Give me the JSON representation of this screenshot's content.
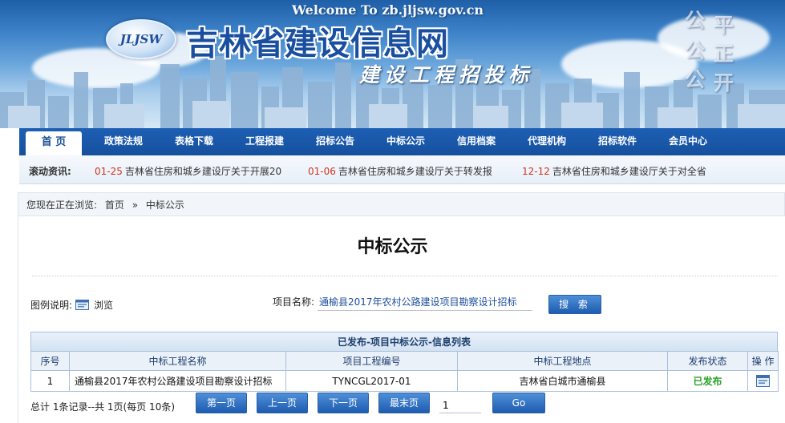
{
  "header": {
    "welcome": "Welcome To zb.jljsw.gov.cn",
    "logo_text": "JLJSW",
    "site_title": "吉林省建设信息网",
    "site_subtitle": "建设工程招投标",
    "slogan_chars": [
      "公",
      "平",
      "公",
      "正",
      "公",
      "开"
    ]
  },
  "nav": {
    "items": [
      "首 页",
      "政策法规",
      "表格下载",
      "工程报建",
      "招标公告",
      "中标公示",
      "信用档案",
      "代理机构",
      "招标软件",
      "会员中心"
    ]
  },
  "ticker": {
    "label": "滚动资讯:",
    "items": [
      {
        "date": "01-25",
        "text": "吉林省住房和城乡建设厅关于开展20"
      },
      {
        "date": "01-06",
        "text": "吉林省住房和城乡建设厅关于转发报"
      },
      {
        "date": "12-12",
        "text": "吉林省住房和城乡建设厅关于对全省"
      }
    ]
  },
  "breadcrumb": {
    "prefix": "您现在正在浏览:",
    "home": "首页",
    "separator": "»",
    "current": "中标公示"
  },
  "page": {
    "title": "中标公示"
  },
  "legend": {
    "label": "图例说明:",
    "icon": "browse-icon",
    "browse_text": "浏览"
  },
  "search": {
    "label": "项目名称:",
    "value": "通榆县2017年农村公路建设项目勘察设计招标",
    "button": "搜 索"
  },
  "table": {
    "caption": "已发布-项目中标公示-信息列表",
    "columns": [
      "序号",
      "中标工程名称",
      "项目工程编号",
      "中标工程地点",
      "发布状态",
      "操 作"
    ],
    "rows": [
      {
        "index": "1",
        "name": "通榆县2017年农村公路建设项目勘察设计招标",
        "code": "TYNCGL2017-01",
        "location": "吉林省白城市通榆县",
        "status": "已发布"
      }
    ]
  },
  "pager": {
    "info": "总计 1条记录--共 1页(每页 10条)",
    "first": "第一页",
    "prev": "上一页",
    "next": "下一页",
    "last": "最末页",
    "page_value": "1",
    "go": "Go"
  },
  "colors": {
    "nav_bg": "#1a56a8",
    "ticker_date": "#d0321e",
    "status_published": "#2aa12a",
    "button_bg": "#1e5cb0"
  }
}
